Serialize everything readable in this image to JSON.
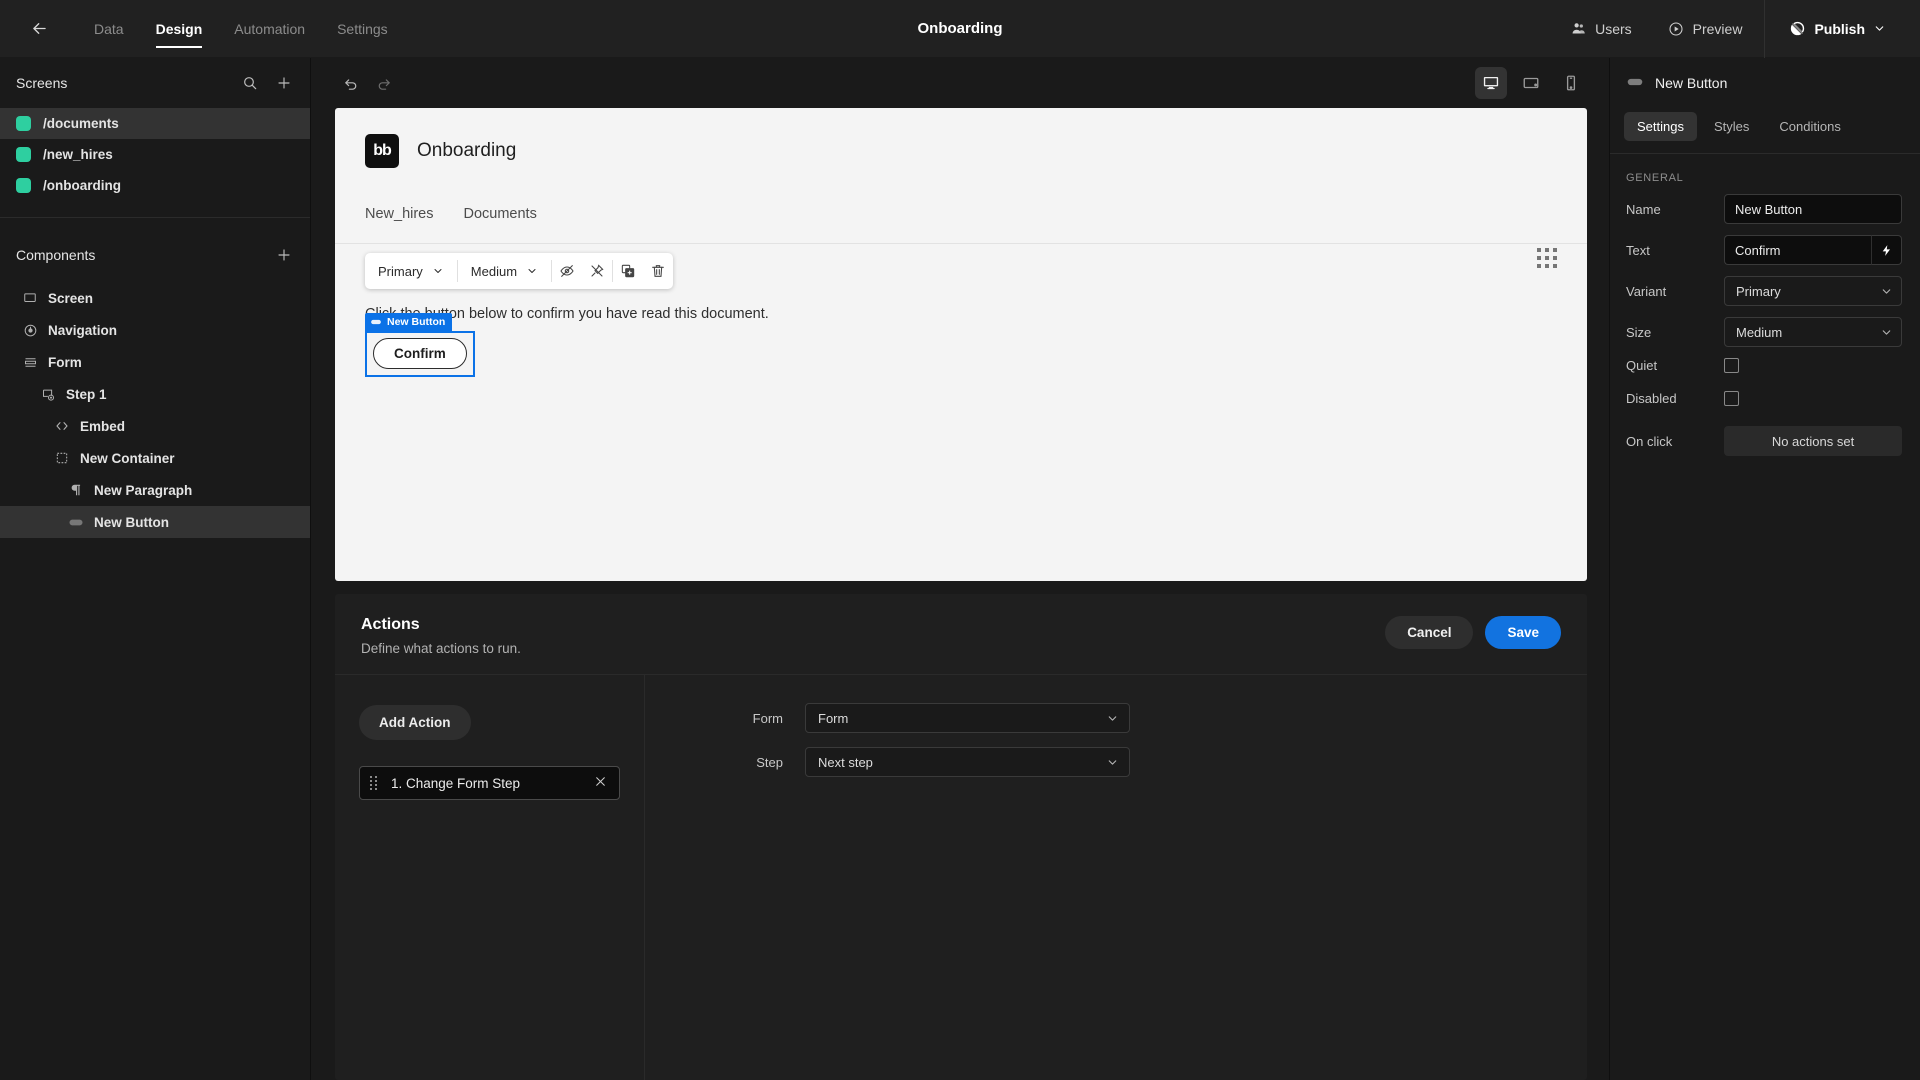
{
  "topbar": {
    "back_icon": "arrow-left-icon",
    "nav": [
      {
        "label": "Data",
        "active": false
      },
      {
        "label": "Design",
        "active": true
      },
      {
        "label": "Automation",
        "active": false
      },
      {
        "label": "Settings",
        "active": false
      }
    ],
    "title": "Onboarding",
    "users_label": "Users",
    "preview_label": "Preview",
    "publish_label": "Publish"
  },
  "screens_panel": {
    "title": "Screens",
    "search_icon": "search-icon",
    "add_icon": "plus-icon",
    "items": [
      {
        "label": "/documents",
        "selected": true
      },
      {
        "label": "/new_hires",
        "selected": false
      },
      {
        "label": "/onboarding",
        "selected": false
      }
    ],
    "accent": "#2ecfa0"
  },
  "components_panel": {
    "title": "Components",
    "add_icon": "plus-icon",
    "items": [
      {
        "label": "Screen",
        "icon": "screen-icon",
        "depth": 0,
        "selected": false
      },
      {
        "label": "Navigation",
        "icon": "navigation-eye-icon",
        "depth": 0,
        "selected": false
      },
      {
        "label": "Form",
        "icon": "form-icon",
        "depth": 0,
        "selected": false
      },
      {
        "label": "Step 1",
        "icon": "step-icon",
        "depth": 1,
        "selected": false
      },
      {
        "label": "Embed",
        "icon": "code-embed-icon",
        "depth": 2,
        "selected": false
      },
      {
        "label": "New Container",
        "icon": "container-icon",
        "depth": 2,
        "selected": false
      },
      {
        "label": "New Paragraph",
        "icon": "paragraph-icon",
        "depth": 3,
        "selected": false
      },
      {
        "label": "New Button",
        "icon": "button-icon",
        "depth": 3,
        "selected": true
      }
    ]
  },
  "canvas_toolbar": {
    "undo_icon": "undo-icon",
    "redo_icon": "redo-icon",
    "devices": [
      {
        "name": "desktop",
        "icon": "desktop-icon",
        "active": true
      },
      {
        "name": "tablet",
        "icon": "tablet-icon",
        "active": false
      },
      {
        "name": "mobile",
        "icon": "mobile-icon",
        "active": false
      }
    ]
  },
  "canvas": {
    "logo_text": "bb",
    "app_title": "Onboarding",
    "grid_icon": "grid-dots-icon",
    "tabs": [
      "New_hires",
      "Documents"
    ],
    "float_toolbar": {
      "variant": "Primary",
      "size": "Medium",
      "hide_icon": "eye-off-icon",
      "unpin_icon": "unpin-icon",
      "duplicate_icon": "duplicate-icon",
      "delete_icon": "trash-icon"
    },
    "paragraph": "Click the button below to confirm you have read this document.",
    "selection_badge": "New Button",
    "selection_badge_icon": "button-icon",
    "button_label": "Confirm",
    "selection_color": "#0b72e7"
  },
  "actions": {
    "heading": "Actions",
    "subheading": "Define what actions to run.",
    "cancel_label": "Cancel",
    "save_label": "Save",
    "add_action_label": "Add Action",
    "action_items": [
      {
        "label": "1. Change Form Step",
        "close_icon": "close-icon"
      }
    ],
    "fields": [
      {
        "label": "Form",
        "value": "Form"
      },
      {
        "label": "Step",
        "value": "Next step"
      }
    ]
  },
  "settings_panel": {
    "component_icon": "button-icon",
    "component_name": "New Button",
    "tabs": [
      {
        "label": "Settings",
        "active": true
      },
      {
        "label": "Styles",
        "active": false
      },
      {
        "label": "Conditions",
        "active": false
      }
    ],
    "section_label": "GENERAL",
    "props": [
      {
        "label": "Name",
        "type": "text",
        "value": "New Button"
      },
      {
        "label": "Text",
        "type": "text-binding",
        "value": "Confirm",
        "binding_icon": "lightning-bolt-icon"
      },
      {
        "label": "Variant",
        "type": "select",
        "value": "Primary"
      },
      {
        "label": "Size",
        "type": "select",
        "value": "Medium"
      },
      {
        "label": "Quiet",
        "type": "checkbox",
        "value": false
      },
      {
        "label": "Disabled",
        "type": "checkbox",
        "value": false
      },
      {
        "label": "On click",
        "type": "button",
        "value": "No actions set"
      }
    ]
  }
}
